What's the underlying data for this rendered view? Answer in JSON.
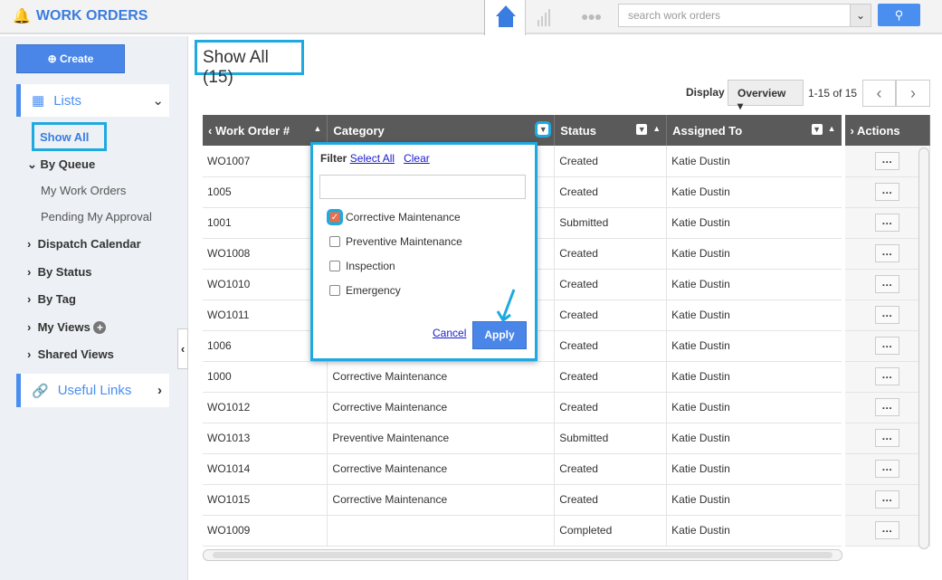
{
  "header": {
    "app_title": "WORK ORDERS",
    "search_placeholder": "search work orders",
    "icons": [
      "bell-icon",
      "home-icon",
      "bar-chart-icon",
      "more-dots-icon",
      "search-icon"
    ]
  },
  "sidebar": {
    "create_label": "Create",
    "lists_label": "Lists",
    "show_all": "Show All",
    "by_queue": "By Queue",
    "my_work_orders": "My Work Orders",
    "pending_approval": "Pending My Approval",
    "dispatch_calendar": "Dispatch Calendar",
    "by_status": "By Status",
    "by_tag": "By Tag",
    "my_views": "My Views",
    "shared_views": "Shared Views",
    "useful_links": "Useful Links"
  },
  "main": {
    "title": "Show All (15)",
    "display_label": "Display",
    "display_value": "Overview",
    "pagination": "1-15 of 15"
  },
  "table": {
    "columns": [
      "Work Order #",
      "Category",
      "Status",
      "Assigned To",
      "Actions"
    ],
    "rows": [
      [
        "WO1007",
        "",
        "Created",
        "Katie Dustin"
      ],
      [
        "1005",
        "",
        "Created",
        "Katie Dustin"
      ],
      [
        "1001",
        "",
        "Submitted",
        "Katie Dustin"
      ],
      [
        "WO1008",
        "",
        "Created",
        "Katie Dustin"
      ],
      [
        "WO1010",
        "",
        "Created",
        "Katie Dustin"
      ],
      [
        "WO1011",
        "",
        "Created",
        "Katie Dustin"
      ],
      [
        "1006",
        "",
        "Created",
        "Katie Dustin"
      ],
      [
        "1000",
        "Corrective Maintenance",
        "Created",
        "Katie Dustin"
      ],
      [
        "WO1012",
        "Corrective Maintenance",
        "Created",
        "Katie Dustin"
      ],
      [
        "WO1013",
        "Preventive Maintenance",
        "Submitted",
        "Katie Dustin"
      ],
      [
        "WO1014",
        "Corrective Maintenance",
        "Created",
        "Katie Dustin"
      ],
      [
        "WO1015",
        "Corrective Maintenance",
        "Created",
        "Katie Dustin"
      ],
      [
        "WO1009",
        "",
        "Completed",
        "Katie Dustin"
      ]
    ]
  },
  "filter": {
    "label": "Filter",
    "select_all": "Select All",
    "clear": "Clear",
    "search_value": "",
    "options": [
      {
        "label": "Corrective Maintenance",
        "checked": true
      },
      {
        "label": "Preventive Maintenance",
        "checked": false
      },
      {
        "label": "Inspection",
        "checked": false
      },
      {
        "label": "Emergency",
        "checked": false
      }
    ],
    "cancel": "Cancel",
    "apply": "Apply"
  },
  "colors": {
    "accent": "#4a86e8",
    "highlight": "#1fa9e1",
    "header_bg": "#5a5a5a",
    "checked": "#e8704a"
  }
}
